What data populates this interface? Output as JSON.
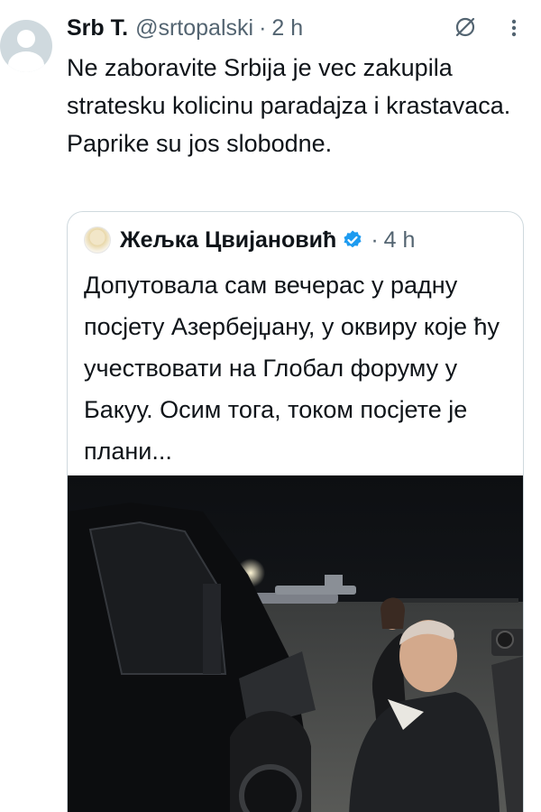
{
  "tweet": {
    "author_name": "Srb T.",
    "handle": "@srtopalski",
    "separator": "·",
    "time": "2 h",
    "text": "Ne zaboravite Srbija  je vec zakupila stratesku kolicinu paradajza i krastavaca. Paprike su jos slobodne.",
    "icons": [
      "default-avatar-icon",
      "grok-icon",
      "more-options-icon"
    ]
  },
  "quote": {
    "author_name": "Жељка Цвијановић",
    "separator": "·",
    "time": "4 h",
    "text": "Допутовала сам вечерас у радну посјету Азербејџану, у оквиру које ћу учествовати на Глобал форуму у Бакуу. Осим тога, током посјете је плани...",
    "icons": [
      "verified-badge-icon"
    ]
  },
  "colors": {
    "text_primary": "#0f1419",
    "text_secondary": "#536471",
    "border": "#cfd9de",
    "verified_blue": "#1d9bf0"
  }
}
